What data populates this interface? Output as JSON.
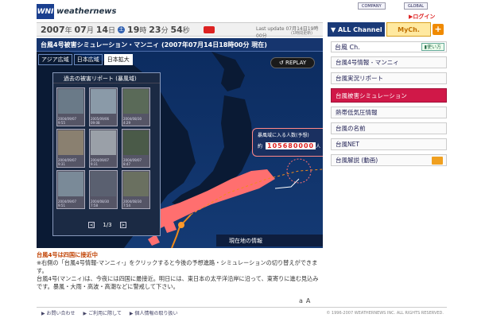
{
  "header": {
    "logo_mark": "WNI",
    "logo_text": "weathernews",
    "company": "COMPANY",
    "global": "GLOBAL",
    "login": "ログイン"
  },
  "datebar": {
    "year": "2007",
    "year_unit": "年",
    "month": "07",
    "month_unit": "月",
    "day": "14",
    "day_unit": "日",
    "weekday": "土",
    "hour": "19",
    "hour_unit": "時",
    "minute": "23",
    "minute_unit": "分",
    "second": "54",
    "second_unit": "秒",
    "last_update_label": "Last update",
    "last_update": "07月14日19時00分",
    "interval": "(1時間更新)"
  },
  "tabs": {
    "all": "ALL Channel",
    "my": "MyCh.",
    "add": "+"
  },
  "main": {
    "title": "台風4号被害シミュレーション・マンニィ (2007年07月14日18時00分 現在)",
    "regions": [
      "アジア広域",
      "日本広域",
      "日本拡大"
    ],
    "replay": "REPLAY",
    "current_info": "現在地の情報",
    "popup": {
      "title": "暴風域に入る人数(予想)",
      "prefix": "約",
      "number": "105680000",
      "suffix": "人"
    },
    "reports": {
      "title": "過去の被害リポート (暴風域)",
      "page": "1/3",
      "prev": "<",
      "next": ">",
      "items": [
        {
          "date": "2004/09/07",
          "time": "9:55"
        },
        {
          "date": "2005/09/06",
          "time": "09:08"
        },
        {
          "date": "2004/08/30",
          "time": "4:29"
        },
        {
          "date": "2004/09/07",
          "time": "9:31"
        },
        {
          "date": "2004/09/07",
          "time": "9:31"
        },
        {
          "date": "2004/09/07",
          "time": "8:47"
        },
        {
          "date": "2004/09/07",
          "time": "9:51"
        },
        {
          "date": "2004/08/30",
          "time": "7:58"
        },
        {
          "date": "2004/08/30",
          "time": "7:54"
        }
      ]
    }
  },
  "caption": {
    "title": "台風4号は四国に接近中",
    "note": "※右側の「台風4号情報-マンニィ-」をクリックすると今後の予想進路・シミュレーションの切り替えができます。",
    "body": "台風4号(マンニィ)は、今夜には四国に最接近。明日には、東日本の太平洋沿岸に沿って、東寄りに進む見込みです。暴風・大雨・高波・高潮などに警戒して下さい。"
  },
  "textsize": {
    "small": "a",
    "large": "A"
  },
  "sidebar": {
    "title": "台風 Ch.",
    "help": "使い方",
    "items": [
      {
        "label": "台風4号情報 - マンニィ"
      },
      {
        "label": "台風実況リポート"
      },
      {
        "label": "台風被害シミュレーション"
      },
      {
        "label": "熱帯低気圧情報"
      },
      {
        "label": "台風の名前"
      },
      {
        "label": "台風NET"
      },
      {
        "label": "台風解説 (動画)"
      }
    ]
  },
  "footer": {
    "links": [
      "お問い合わせ",
      "ご利用に際して",
      "個人情報の取り扱い"
    ],
    "copyright": "© 1996-2007 WEATHERNEWS INC. ALL RIGHTS RESERVED."
  },
  "colors": {
    "accent": "#d01848",
    "navy": "#16356e",
    "storm": "#ff6f6f"
  }
}
